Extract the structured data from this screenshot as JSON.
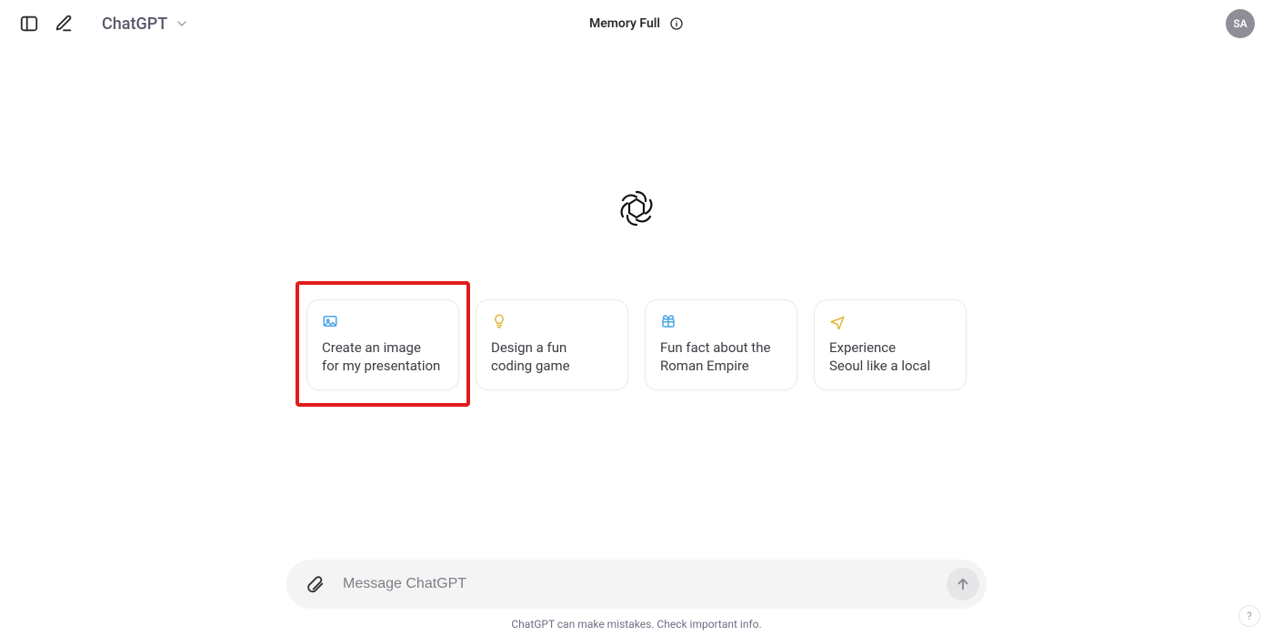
{
  "header": {
    "model_label": "ChatGPT",
    "memory_label": "Memory Full"
  },
  "user": {
    "initials": "SA"
  },
  "suggestions": [
    {
      "icon": "image-icon",
      "icon_color": "blue",
      "line1": "Create an image",
      "line2": "for my presentation"
    },
    {
      "icon": "lightbulb-icon",
      "icon_color": "gold",
      "line1": "Design a fun",
      "line2": "coding game"
    },
    {
      "icon": "gift-icon",
      "icon_color": "blue",
      "line1": "Fun fact about the",
      "line2": "Roman Empire"
    },
    {
      "icon": "plane-icon",
      "icon_color": "gold",
      "line1": "Experience",
      "line2": "Seoul like a local"
    }
  ],
  "input": {
    "placeholder": "Message ChatGPT"
  },
  "footer": {
    "disclaimer": "ChatGPT can make mistakes. Check important info."
  },
  "help": {
    "label": "?"
  }
}
